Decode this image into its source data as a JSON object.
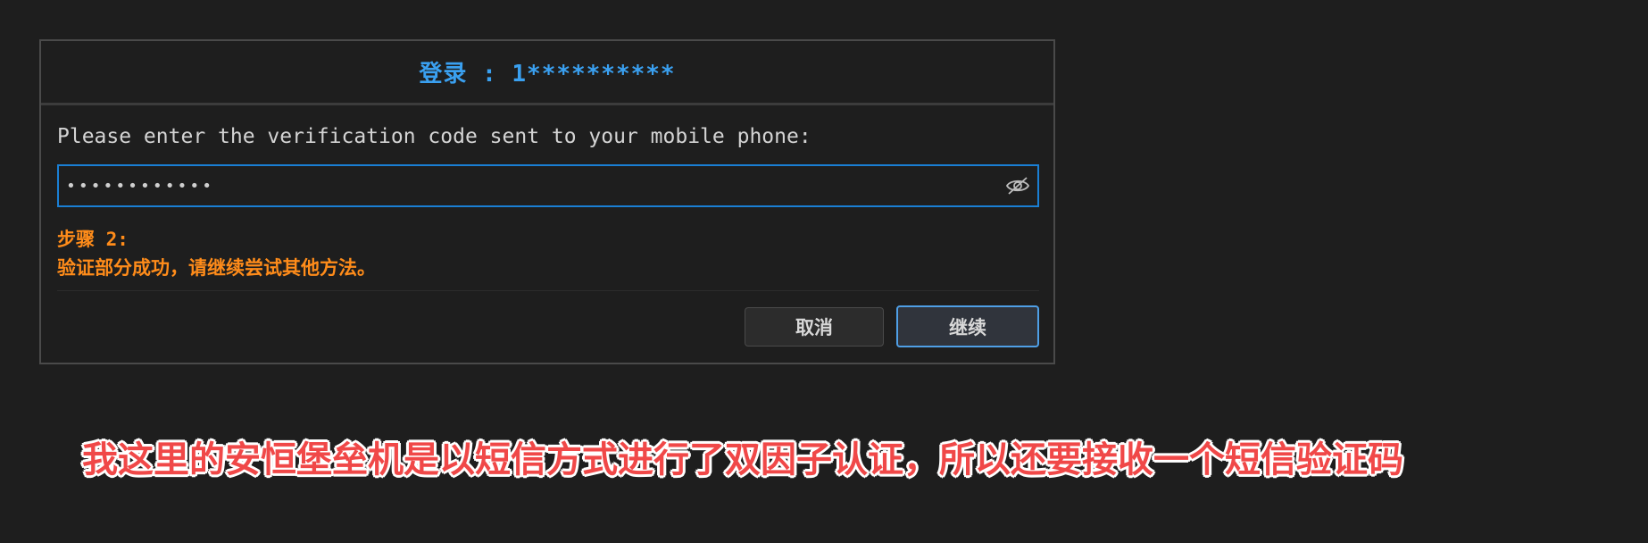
{
  "dialog": {
    "title": "登录 : 1**********",
    "prompt": "Please enter the verification code sent to your mobile phone:",
    "code_field": {
      "value": "••••••••••••",
      "type": "password"
    },
    "visibility_icon": "eye-slash-icon",
    "status": {
      "step": "步骤 2:",
      "message": "验证部分成功，请继续尝试其他方法。"
    },
    "buttons": {
      "cancel_label": "取消",
      "continue_label": "继续"
    }
  },
  "annotation": {
    "caption": "我这里的安恒堡垒机是以短信方式进行了双因子认证，所以还要接收一个短信验证码"
  },
  "colors": {
    "background": "#1e1e1e",
    "title": "#3aa0f0",
    "status": "#ff8c1a",
    "field_border": "#1a7fd4",
    "caption": "#f04848"
  }
}
